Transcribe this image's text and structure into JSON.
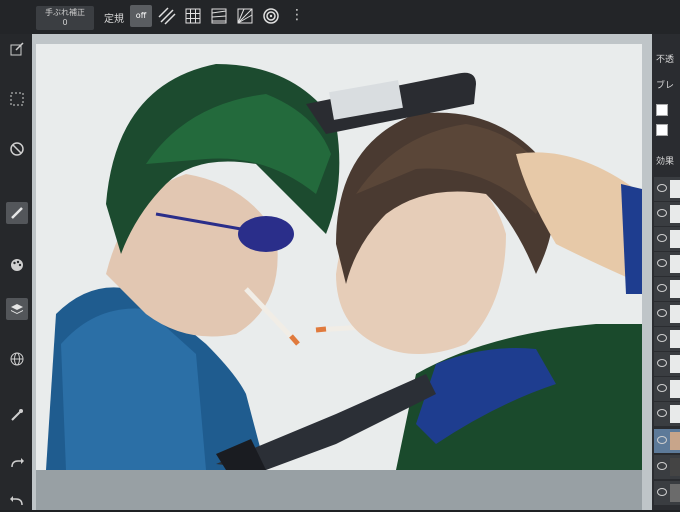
{
  "toolbar": {
    "stabilizer_label": "手ぶれ補正",
    "stabilizer_value": "0",
    "ruler_label": "定規",
    "ruler_off_label": "off",
    "ruler_buttons": [
      "off",
      "parallel",
      "grid",
      "perspective",
      "concentric-lines",
      "ellipse"
    ],
    "menu_icon": "more-vert-icon"
  },
  "left_tools": [
    {
      "name": "edit-icon"
    },
    {
      "name": "select-icon"
    },
    {
      "name": "no-icon"
    },
    {
      "name": "brush-icon",
      "active": true
    },
    {
      "name": "palette-icon"
    },
    {
      "name": "layers-icon",
      "active": true
    },
    {
      "name": "globe-icon"
    },
    {
      "name": "eyedropper-icon"
    },
    {
      "name": "redo-icon"
    },
    {
      "name": "undo-icon"
    }
  ],
  "right_panel": {
    "opacity_label": "不透",
    "blend_label": "ブレ",
    "effect_label": "効果"
  }
}
